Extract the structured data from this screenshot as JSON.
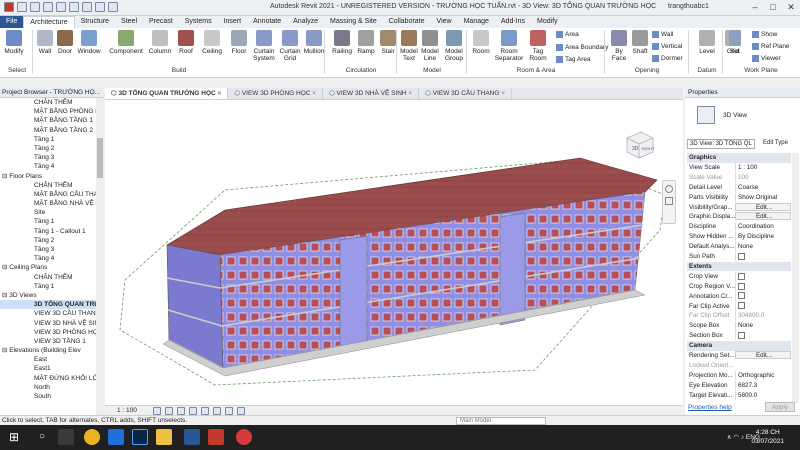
{
  "window": {
    "title": "Autodesk Revit 2021 - UNREGISTERED VERSION - TRƯỜNG HỌC TUẤN.rvt - 3D View: 3D TỔNG QUAN TRƯỜNG HỌC",
    "user": "trangthuabc1"
  },
  "ribbon_tabs": [
    "File",
    "Architecture",
    "Structure",
    "Steel",
    "Precast",
    "Systems",
    "Insert",
    "Annotate",
    "Analyze",
    "Massing & Site",
    "Collaborate",
    "View",
    "Manage",
    "Add-Ins",
    "Modify"
  ],
  "ribbon": {
    "buttons": [
      "Modify",
      "Wall",
      "Door",
      "Window",
      "Component",
      "Column",
      "Roof",
      "Ceiling",
      "Floor",
      "Curtain System",
      "Curtain Grid",
      "Mullion",
      "Railing",
      "Ramp",
      "Stair",
      "Model Text",
      "Model Line",
      "Model Group",
      "Room",
      "Room Separator",
      "Tag Room",
      "By Face",
      "Shaft",
      "Level",
      "Grid",
      "Set"
    ],
    "small": {
      "area": "Area",
      "area_boundary": "Area Boundary",
      "tag_area": "Tag Area",
      "wall": "Wall",
      "vertical": "Vertical",
      "dormer": "Dormer",
      "show": "Show",
      "ref_plane": "Ref Plane",
      "viewer": "Viewer"
    },
    "groups": [
      "Select",
      "Build",
      "Circulation",
      "Model",
      "Room & Area",
      "Opening",
      "Datum",
      "Work Plane"
    ]
  },
  "project_browser": {
    "title": "Project Browser - TRƯỜNG HỌ...",
    "items": [
      {
        "label": "CHÂN THÊM",
        "indent": 3
      },
      {
        "label": "MẶT BẰNG PHÒNG H",
        "indent": 3
      },
      {
        "label": "MẶT BẰNG TẦNG 1",
        "indent": 3
      },
      {
        "label": "MẶT BẰNG TẦNG 2",
        "indent": 3
      },
      {
        "label": "Tầng 1",
        "indent": 3
      },
      {
        "label": "Tầng 2",
        "indent": 3
      },
      {
        "label": "Tầng 3",
        "indent": 3
      },
      {
        "label": "Tầng 4",
        "indent": 3
      },
      {
        "label": "Floor Plans",
        "indent": 1
      },
      {
        "label": "CHÂN THÊM",
        "indent": 3
      },
      {
        "label": "MẶT BẰNG CẦU THA",
        "indent": 3
      },
      {
        "label": "MẶT BẰNG NHÀ VỆ S",
        "indent": 3
      },
      {
        "label": "Site",
        "indent": 3
      },
      {
        "label": "Tầng 1",
        "indent": 3
      },
      {
        "label": "Tầng 1 - Callout 1",
        "indent": 3
      },
      {
        "label": "Tầng 2",
        "indent": 3
      },
      {
        "label": "Tầng 3",
        "indent": 3
      },
      {
        "label": "Tầng 4",
        "indent": 3
      },
      {
        "label": "Ceiling Plans",
        "indent": 1
      },
      {
        "label": "CHÂN THÊM",
        "indent": 3
      },
      {
        "label": "Tầng 1",
        "indent": 3
      },
      {
        "label": "3D Views",
        "indent": 1
      },
      {
        "label": "3D TỔNG QUAN TRƯ",
        "indent": 3,
        "sel": true
      },
      {
        "label": "VIEW 3D CẦU THANG",
        "indent": 3
      },
      {
        "label": "VIEW 3D NHÀ VỆ SIN",
        "indent": 3
      },
      {
        "label": "VIEW 3D PHÒNG HỌC",
        "indent": 3
      },
      {
        "label": "VIEW 3D TẦNG 1",
        "indent": 3
      },
      {
        "label": "Elevations (Building Elev",
        "indent": 1
      },
      {
        "label": "East",
        "indent": 3
      },
      {
        "label": "East1",
        "indent": 3
      },
      {
        "label": "MẶT ĐỨNG KHỐI LỚ",
        "indent": 3
      },
      {
        "label": "North",
        "indent": 3
      },
      {
        "label": "South",
        "indent": 3
      }
    ]
  },
  "view_tabs": [
    "3D TỔNG QUAN TRƯỜNG HỌC",
    "VIEW 3D PHÒNG HỌC",
    "VIEW 3D NHÀ VỆ SINH",
    "VIEW 3D CẦU THANG"
  ],
  "view_control": {
    "scale": "1 : 100"
  },
  "properties": {
    "title": "Properties",
    "type": "3D View",
    "selector": "3D View: 3D TỔNG QL",
    "edit_type": "Edit Type",
    "rows": [
      {
        "k": "Graphics",
        "grp": true
      },
      {
        "k": "View Scale",
        "v": "1 : 100"
      },
      {
        "k": "Scale Value",
        "v": "100",
        "grey": true
      },
      {
        "k": "Detail Level",
        "v": "Coarse"
      },
      {
        "k": "Parts Visibility",
        "v": "Show Original"
      },
      {
        "k": "Visibility/Grap...",
        "v": "Edit...",
        "btn": true
      },
      {
        "k": "Graphic Displa...",
        "v": "Edit...",
        "btn": true
      },
      {
        "k": "Discipline",
        "v": "Coordination"
      },
      {
        "k": "Show Hidden ...",
        "v": "By Discipline"
      },
      {
        "k": "Default Analys...",
        "v": "None"
      },
      {
        "k": "Sun Path",
        "cb": true
      },
      {
        "k": "Extents",
        "grp": true
      },
      {
        "k": "Crop View",
        "cb": true
      },
      {
        "k": "Crop Region V...",
        "cb": true
      },
      {
        "k": "Annotation Cr...",
        "cb": true
      },
      {
        "k": "Far Clip Active",
        "cb": true
      },
      {
        "k": "Far Clip Offset",
        "v": "304800.0",
        "grey": true
      },
      {
        "k": "Scope Box",
        "v": "None"
      },
      {
        "k": "Section Box",
        "cb": true
      },
      {
        "k": "Camera",
        "grp": true
      },
      {
        "k": "Rendering Set...",
        "v": "Edit...",
        "btn": true
      },
      {
        "k": "Locked Orient...",
        "grey": true
      },
      {
        "k": "Projection Mo...",
        "v": "Orthographic"
      },
      {
        "k": "Eye Elevation",
        "v": "6827.3"
      },
      {
        "k": "Target Elevati...",
        "v": "5800.0"
      }
    ],
    "help": "Properties help",
    "apply": "Apply"
  },
  "status": {
    "text": "Click to select, TAB for alternates, CTRL adds, SHIFT unselects.",
    "model": "Main Model"
  },
  "taskbar": {
    "lang": "ENG",
    "time": "4:28 CH",
    "date": "03/07/2021"
  },
  "viewcube": {
    "face": "3D",
    "right": "RIGHT"
  }
}
